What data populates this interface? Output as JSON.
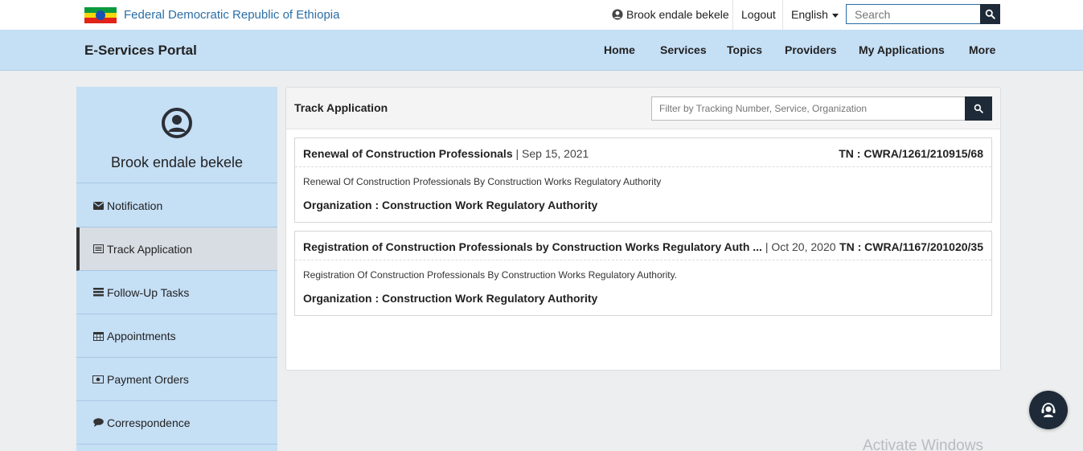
{
  "topbar": {
    "brand": "Federal Democratic Republic of Ethiopia",
    "user_name": "Brook endale bekele",
    "logout": "Logout",
    "language": "English",
    "search_placeholder": "Search"
  },
  "navbar": {
    "title": "E-Services Portal",
    "items": [
      "Home",
      "Services",
      "Topics",
      "Providers",
      "My Applications",
      "More"
    ]
  },
  "sidebar": {
    "user_name": "Brook endale bekele",
    "items": [
      {
        "label": "Notification",
        "icon": "envelope-icon"
      },
      {
        "label": "Track Application",
        "icon": "list-alt-icon"
      },
      {
        "label": "Follow-Up Tasks",
        "icon": "tasks-icon"
      },
      {
        "label": "Appointments",
        "icon": "calendar-icon"
      },
      {
        "label": "Payment Orders",
        "icon": "money-icon"
      },
      {
        "label": "Correspondence",
        "icon": "comment-icon"
      }
    ]
  },
  "main": {
    "title": "Track Application",
    "filter_placeholder": "Filter by Tracking Number, Service, Organization",
    "applications": [
      {
        "name": "Renewal of Construction Professionals",
        "date": "| Sep 15, 2021",
        "tn": "TN : CWRA/1261/210915/68",
        "description": "Renewal Of Construction Professionals By Construction Works Regulatory Authority",
        "organization": "Organization : Construction Work Regulatory Authority"
      },
      {
        "name": "Registration of Construction Professionals by Construction Works Regulatory Auth ...",
        "date": "| Oct 20, 2020",
        "tn": "TN : CWRA/1167/201020/35",
        "description": "Registration Of Construction Professionals By Construction Works Regulatory Authority.",
        "organization": "Organization : Construction Work Regulatory Authority"
      }
    ]
  },
  "watermark": "Activate Windows",
  "colors": {
    "nav_bg": "#c5dff5",
    "dark": "#1e2a38",
    "brand_blue": "#2b6ea6"
  }
}
